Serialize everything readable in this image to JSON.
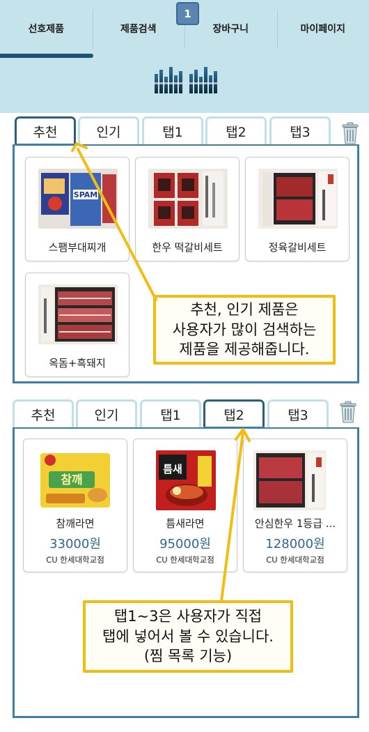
{
  "nav": {
    "items": [
      {
        "label": "선호제품"
      },
      {
        "label": "제품검색"
      },
      {
        "label": "장바구니"
      },
      {
        "label": "마이페이지"
      }
    ],
    "badge": "1"
  },
  "colors": {
    "header_bg": "#c5e3ea",
    "accent": "#3d7fa6",
    "price": "#2b6a8e",
    "callout_border": "#f2bd12"
  },
  "panel_top": {
    "tabs": [
      {
        "label": "추천",
        "active": true
      },
      {
        "label": "인기",
        "active": false
      },
      {
        "label": "탭1",
        "active": false
      },
      {
        "label": "탭2",
        "active": false
      },
      {
        "label": "탭3",
        "active": false
      }
    ],
    "trash_icon": "trash-icon",
    "products": [
      {
        "name": "스팸부대찌개"
      },
      {
        "name": "한우 떡갈비세트"
      },
      {
        "name": "정육갈비세트"
      },
      {
        "name": "옥돔+흑돼지"
      }
    ],
    "callout": [
      "추천, 인기 제품은",
      "사용자가 많이 검색하는",
      "제품을 제공해줍니다."
    ]
  },
  "panel_bottom": {
    "tabs": [
      {
        "label": "추천",
        "active": false
      },
      {
        "label": "인기",
        "active": false
      },
      {
        "label": "탭1",
        "active": false
      },
      {
        "label": "탭2",
        "active": true
      },
      {
        "label": "탭3",
        "active": false
      }
    ],
    "trash_icon": "trash-icon",
    "products": [
      {
        "name": "참깨라면",
        "price": "33000원",
        "store": "CU 한세대학교점"
      },
      {
        "name": "틈새라면",
        "price": "95000원",
        "store": "CU 한세대학교점"
      },
      {
        "name": "안심한우 1등급 ...",
        "price": "128000원",
        "store": "CU 한세대학교점"
      }
    ],
    "callout": [
      "탭1~3은 사용자가 직접",
      "탭에 넣어서 볼 수 있습니다.",
      "(찜 목록 기능)"
    ]
  }
}
